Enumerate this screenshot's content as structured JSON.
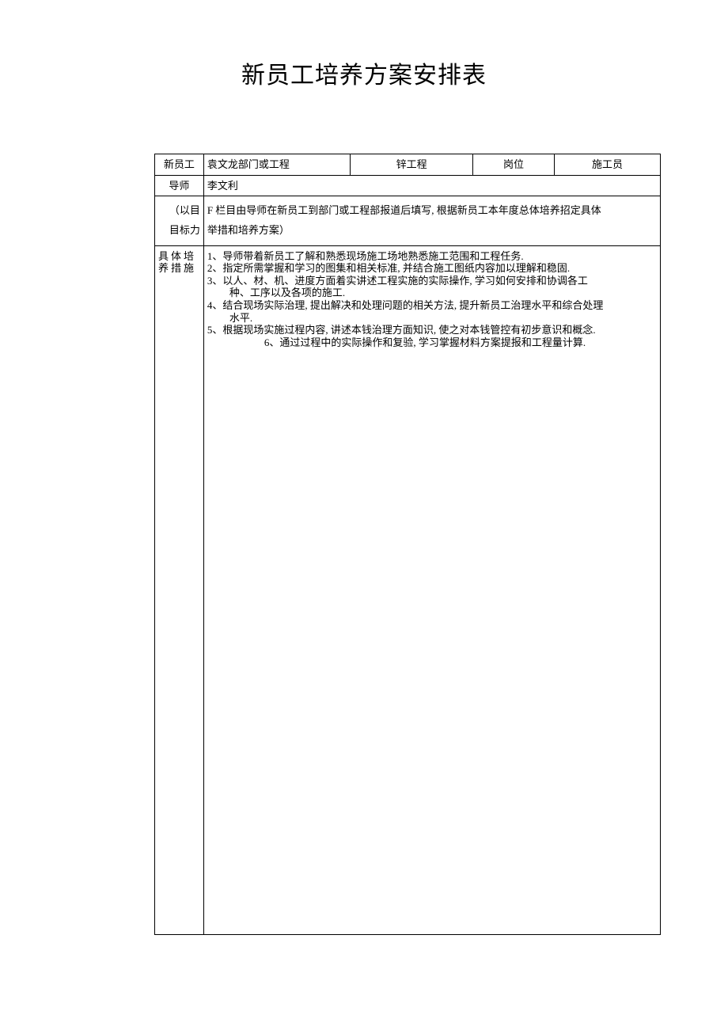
{
  "title": "新员工培养方案安排表",
  "row1": {
    "label": "新员工",
    "name_dept": "袁文龙部门或工程",
    "project": "锌工程",
    "position_label": "岗位",
    "position_value": "施工员"
  },
  "row2": {
    "label": "导师",
    "value": "李文利"
  },
  "note": {
    "left_prefix": "（以目",
    "left_goal": "目标力",
    "right_line1": "F 栏目由导师在新员工到部门或工程部报道后填写, 根据新员工本年度总体培养招定具体",
    "right_line2": "举措和培养方案）"
  },
  "measures": {
    "label": "具体培养措施",
    "items": [
      "1、导师带着新员工了解和熟悉现场施工场地熟悉施工范围和工程任务.",
      "2、指定所需掌握和学习的图集和相关标准, 并结合施工图纸内容加以理解和稳固.",
      "3、以人、材、机、进度方面着实讲述工程实施的实际操作, 学习如何安排和协调各工",
      "种、工序以及各项的施工.",
      "4、结合现场实际治理, 提出解决和处理问题的相关方法, 提升新员工治理水平和综合处理",
      "水平.",
      "5、根据现场实施过程内容, 讲述本钱治理方面知识, 使之对本钱管控有初步意识和概念.",
      "6、通过过程中的实际操作和复验, 学习掌握材料方案提报和工程量计算."
    ]
  }
}
